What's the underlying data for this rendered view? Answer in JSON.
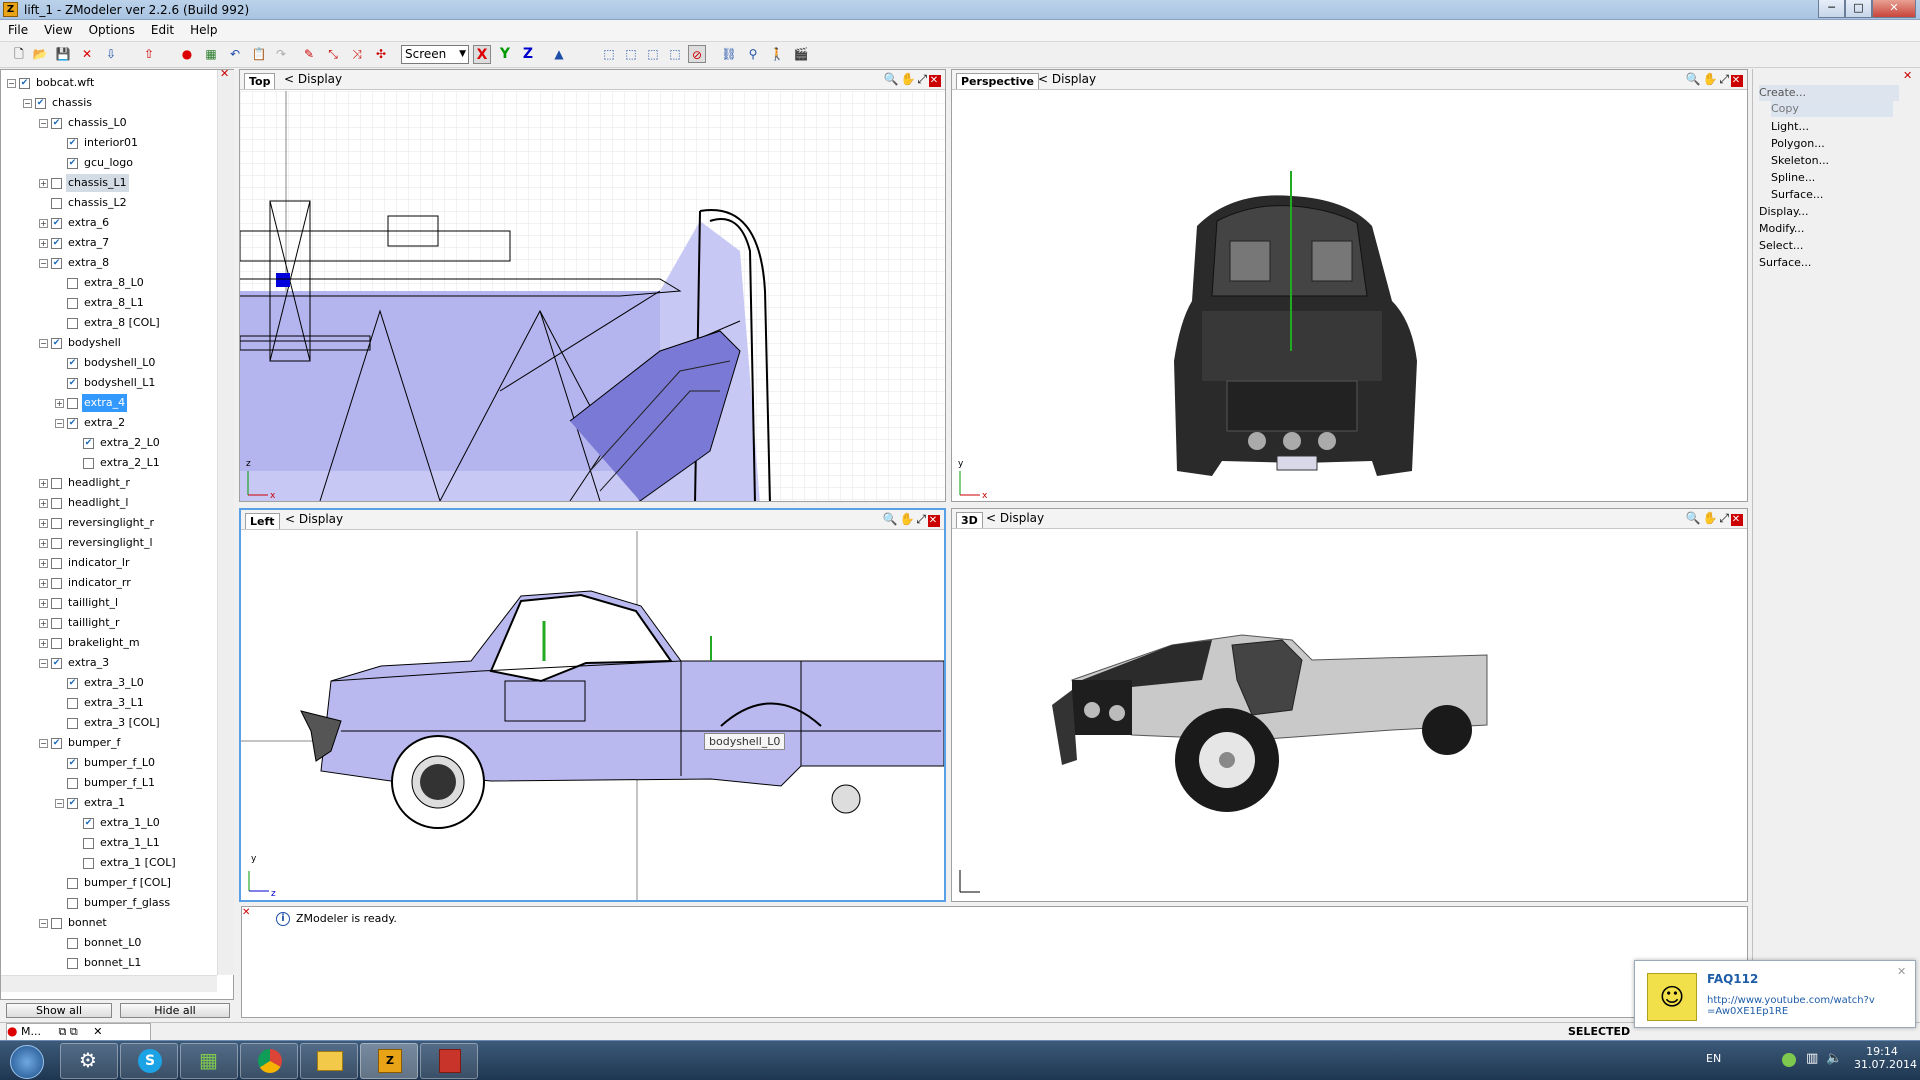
{
  "window": {
    "title": "lift_1 - ZModeler ver 2.2.6 (Build 992)",
    "app_icon": "Z"
  },
  "menu": [
    "File",
    "View",
    "Options",
    "Edit",
    "Help"
  ],
  "toolbar": {
    "space_select": "Screen",
    "axes": [
      "X",
      "Y",
      "Z"
    ]
  },
  "tree": {
    "items": [
      {
        "label": "bobcat.wft",
        "level": 0,
        "checked": true,
        "expander": "minus"
      },
      {
        "label": "chassis",
        "level": 1,
        "checked": true,
        "expander": "minus"
      },
      {
        "label": "chassis_L0",
        "level": 2,
        "checked": true,
        "expander": "minus"
      },
      {
        "label": "interior01",
        "level": 3,
        "checked": true,
        "expander": "none"
      },
      {
        "label": "gcu_logo",
        "level": 3,
        "checked": true,
        "expander": "none"
      },
      {
        "label": "chassis_L1",
        "level": 2,
        "checked": false,
        "expander": "plus",
        "state": "dim"
      },
      {
        "label": "chassis_L2",
        "level": 2,
        "checked": false,
        "expander": "none"
      },
      {
        "label": "extra_6",
        "level": 2,
        "checked": true,
        "expander": "plus"
      },
      {
        "label": "extra_7",
        "level": 2,
        "checked": true,
        "expander": "plus"
      },
      {
        "label": "extra_8",
        "level": 2,
        "checked": true,
        "expander": "minus"
      },
      {
        "label": "extra_8_L0",
        "level": 3,
        "checked": false,
        "expander": "none"
      },
      {
        "label": "extra_8_L1",
        "level": 3,
        "checked": false,
        "expander": "none"
      },
      {
        "label": "extra_8 [COL]",
        "level": 3,
        "checked": false,
        "expander": "none"
      },
      {
        "label": "bodyshell",
        "level": 2,
        "checked": true,
        "expander": "minus"
      },
      {
        "label": "bodyshell_L0",
        "level": 3,
        "checked": true,
        "expander": "none"
      },
      {
        "label": "bodyshell_L1",
        "level": 3,
        "checked": true,
        "expander": "none"
      },
      {
        "label": "extra_4",
        "level": 3,
        "checked": false,
        "expander": "plus",
        "state": "sel"
      },
      {
        "label": "extra_2",
        "level": 3,
        "checked": true,
        "expander": "minus"
      },
      {
        "label": "extra_2_L0",
        "level": 4,
        "checked": true,
        "expander": "none"
      },
      {
        "label": "extra_2_L1",
        "level": 4,
        "checked": false,
        "expander": "none"
      },
      {
        "label": "headlight_r",
        "level": 2,
        "checked": false,
        "expander": "plus"
      },
      {
        "label": "headlight_l",
        "level": 2,
        "checked": false,
        "expander": "plus"
      },
      {
        "label": "reversinglight_r",
        "level": 2,
        "checked": false,
        "expander": "plus"
      },
      {
        "label": "reversinglight_l",
        "level": 2,
        "checked": false,
        "expander": "plus"
      },
      {
        "label": "indicator_lr",
        "level": 2,
        "checked": false,
        "expander": "plus"
      },
      {
        "label": "indicator_rr",
        "level": 2,
        "checked": false,
        "expander": "plus"
      },
      {
        "label": "taillight_l",
        "level": 2,
        "checked": false,
        "expander": "plus"
      },
      {
        "label": "taillight_r",
        "level": 2,
        "checked": false,
        "expander": "plus"
      },
      {
        "label": "brakelight_m",
        "level": 2,
        "checked": false,
        "expander": "plus"
      },
      {
        "label": "extra_3",
        "level": 2,
        "checked": true,
        "expander": "minus"
      },
      {
        "label": "extra_3_L0",
        "level": 3,
        "checked": true,
        "expander": "none"
      },
      {
        "label": "extra_3_L1",
        "level": 3,
        "checked": false,
        "expander": "none"
      },
      {
        "label": "extra_3 [COL]",
        "level": 3,
        "checked": false,
        "expander": "none"
      },
      {
        "label": "bumper_f",
        "level": 2,
        "checked": true,
        "expander": "minus"
      },
      {
        "label": "bumper_f_L0",
        "level": 3,
        "checked": true,
        "expander": "none"
      },
      {
        "label": "bumper_f_L1",
        "level": 3,
        "checked": false,
        "expander": "none"
      },
      {
        "label": "extra_1",
        "level": 3,
        "checked": true,
        "expander": "minus"
      },
      {
        "label": "extra_1_L0",
        "level": 4,
        "checked": true,
        "expander": "none"
      },
      {
        "label": "extra_1_L1",
        "level": 4,
        "checked": false,
        "expander": "none"
      },
      {
        "label": "extra_1 [COL]",
        "level": 4,
        "checked": false,
        "expander": "none"
      },
      {
        "label": "bumper_f [COL]",
        "level": 3,
        "checked": false,
        "expander": "none"
      },
      {
        "label": "bumper_f_glass",
        "level": 3,
        "checked": false,
        "expander": "none"
      },
      {
        "label": "bonnet",
        "level": 2,
        "checked": false,
        "expander": "minus"
      },
      {
        "label": "bonnet_L0",
        "level": 3,
        "checked": false,
        "expander": "none"
      },
      {
        "label": "bonnet_L1",
        "level": 3,
        "checked": false,
        "expander": "none"
      }
    ],
    "show_all": "Show all",
    "hide_all": "Hide all"
  },
  "viewports": {
    "top": {
      "name": "Top",
      "display": "Display",
      "axis_v": "z",
      "axis_h": "x"
    },
    "perspective": {
      "name": "Perspective",
      "display": "Display",
      "axis_v": "y",
      "axis_h": "x"
    },
    "left": {
      "name": "Left",
      "display": "Display",
      "axis_v": "y",
      "axis_h": "z",
      "tooltip": "bodyshell_L0"
    },
    "three_d": {
      "name": "3D",
      "display": "Display"
    }
  },
  "command_panel": {
    "items": [
      "Create...",
      "Copy",
      "Light...",
      "Polygon...",
      "Skeleton...",
      "Spline...",
      "Surface...",
      "Display...",
      "Modify...",
      "Select...",
      "Surface..."
    ]
  },
  "console": {
    "message": "ZModeler is ready."
  },
  "status": {
    "selected": "SELECTED"
  },
  "mini_window": {
    "label": "M..."
  },
  "notification": {
    "title": "FAQ112",
    "url": "http://www.youtube.com/watch?v=Aw0XE1Ep1RE"
  },
  "tray": {
    "lang": "EN",
    "time": "19:14",
    "date": "31.07.2014"
  },
  "colors": {
    "accent": "#3399ff",
    "selection_fill": "#c8c8f5",
    "title_gradient": "#a9c3e1"
  }
}
